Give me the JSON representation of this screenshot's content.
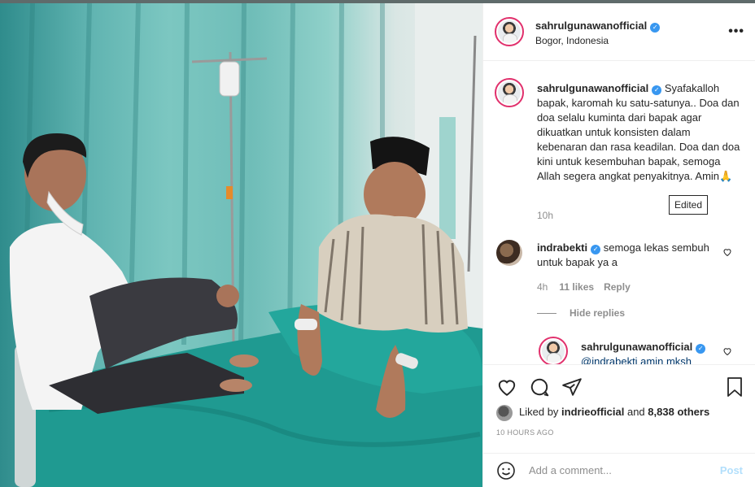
{
  "post": {
    "username": "sahrulgunawanofficial",
    "location": "Bogor, Indonesia",
    "more_icon": "more-horizontal-icon"
  },
  "caption": {
    "username": "sahrulgunawanofficial",
    "text": "Syafakalloh bapak, karomah ku satu-satunya.. Doa dan doa selalu kuminta dari bapak agar dikuatkan untuk konsisten dalam kebenaran dan rasa keadilan. Doa dan doa kini untuk kesembuhan bapak, semoga Allah segera angkat penyakitnya. Amin🙏",
    "time": "10h",
    "edited_label": "Edited"
  },
  "comments": [
    {
      "username": "indrabekti",
      "text": "semoga lekas sembuh untuk bapak ya a",
      "time": "4h",
      "likes": "11 likes",
      "reply_label": "Reply",
      "hide_replies_label": "Hide replies",
      "replies": [
        {
          "username": "sahrulgunawanofficial",
          "text": "@indrabekti amin mksh"
        }
      ]
    }
  ],
  "engagement": {
    "liked_by_prefix": "Liked by",
    "liked_by_user": "indrieofficial",
    "liked_by_suffix": "and",
    "others": "8,838 others",
    "timestamp": "10 HOURS AGO"
  },
  "compose": {
    "placeholder": "Add a comment...",
    "post_label": "Post"
  },
  "colors": {
    "verified": "#3897f0",
    "post_button_disabled": "#b2dffc",
    "avatar_ring": "#e1306c",
    "curtain": "#6fbdb8"
  }
}
